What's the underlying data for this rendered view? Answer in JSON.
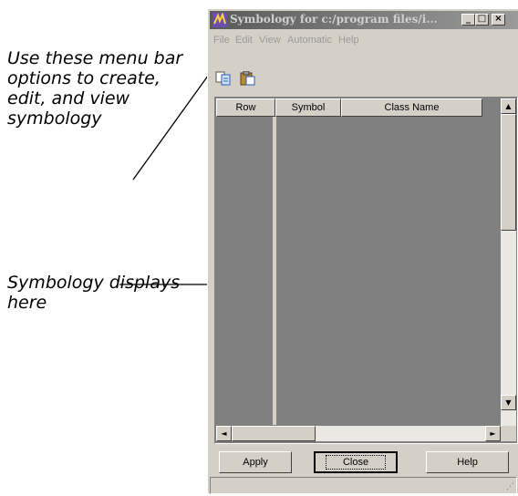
{
  "annotations": {
    "menu_note": "Use these menu bar options to create, edit, and view symbology",
    "display_note": "Symbology displays here"
  },
  "window": {
    "title": "Symbology for c:/program files/i...",
    "controls": {
      "minimize": "_",
      "maximize": "□",
      "close": "×"
    }
  },
  "menu": {
    "items": [
      "File",
      "Edit",
      "View",
      "Automatic",
      "Help"
    ]
  },
  "toolbar": {
    "icons": [
      "copy-icon",
      "paste-icon"
    ]
  },
  "table": {
    "columns": [
      "Row",
      "Symbol",
      "Class Name"
    ],
    "background_color": "#808080"
  },
  "scrollbar": {
    "up": "▲",
    "down": "▼",
    "left": "◄",
    "right": "►"
  },
  "buttons": {
    "apply": "Apply",
    "close": "Close",
    "help": "Help"
  }
}
